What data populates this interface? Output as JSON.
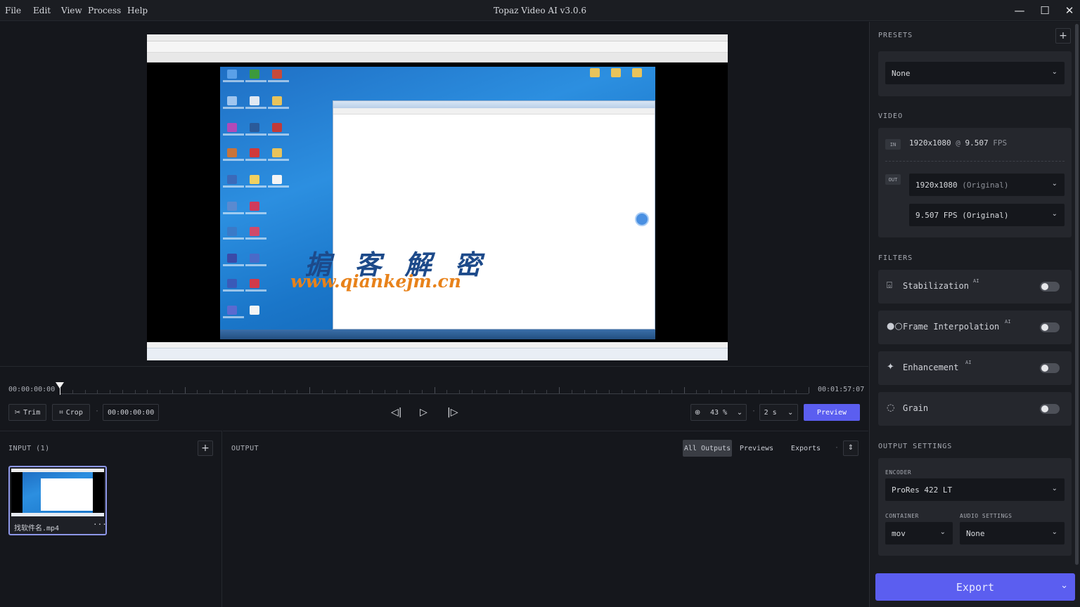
{
  "menu": [
    "File",
    "Edit",
    "View",
    "Process",
    "Help"
  ],
  "app_title": "Topaz Video AI  v3.0.6",
  "window_controls": {
    "minimize": "—",
    "maximize": "☐",
    "close": "✕"
  },
  "video": {
    "watermark_cn": "掮 客 解 密",
    "watermark_url": "www.qiankejm.cn"
  },
  "timeline": {
    "start_time": "00:00:00:00",
    "end_time": "00:01:57:07",
    "playhead_fraction": 0.0,
    "trim_label": "Trim",
    "crop_label": "Crop",
    "current_time": "00:00:00:00",
    "zoom_value": "43 %",
    "preview_duration": "2 s",
    "preview_label": "Preview"
  },
  "input_panel": {
    "title": "INPUT (1)",
    "add_label": "+",
    "file_name": "找软件名.mp4",
    "more_label": "···"
  },
  "output_panel": {
    "title": "OUTPUT",
    "tabs": [
      "All Outputs",
      "Previews",
      "Exports"
    ],
    "active_tab": "All Outputs"
  },
  "sidebar": {
    "presets_title": "PRESETS",
    "presets_add": "+",
    "preset_value": "None",
    "video_title": "VIDEO",
    "in_tag": "IN",
    "out_tag": "OUT",
    "in_resolution": "1920x1080",
    "in_at": "@",
    "in_fps": "9.507",
    "in_fps_unit": "FPS",
    "out_resolution": "1920x1080",
    "out_resolution_note": "(Original)",
    "out_fps": "9.507 FPS",
    "out_fps_note": "(Original)",
    "filters_title": "FILTERS",
    "filters": [
      {
        "label": "Stabilization",
        "ai": "AI",
        "enabled": false,
        "icon": "stabilization-icon"
      },
      {
        "label": "Frame Interpolation",
        "ai": "AI",
        "enabled": false,
        "icon": "frame-interpolation-icon"
      },
      {
        "label": "Enhancement",
        "ai": "AI",
        "enabled": false,
        "icon": "sparkle-icon"
      },
      {
        "label": "Grain",
        "ai": "",
        "enabled": false,
        "icon": "grain-icon"
      }
    ],
    "output_settings_title": "OUTPUT SETTINGS",
    "encoder_label": "ENCODER",
    "encoder_value": "ProRes 422 LT",
    "container_label": "CONTAINER",
    "container_value": "mov",
    "audio_label": "AUDIO SETTINGS",
    "audio_value": "None",
    "export_label": "Export"
  },
  "colors": {
    "accent": "#5b5ef0",
    "background": "#15171c",
    "sidebar": "#1a1c21",
    "card": "#25272d"
  }
}
